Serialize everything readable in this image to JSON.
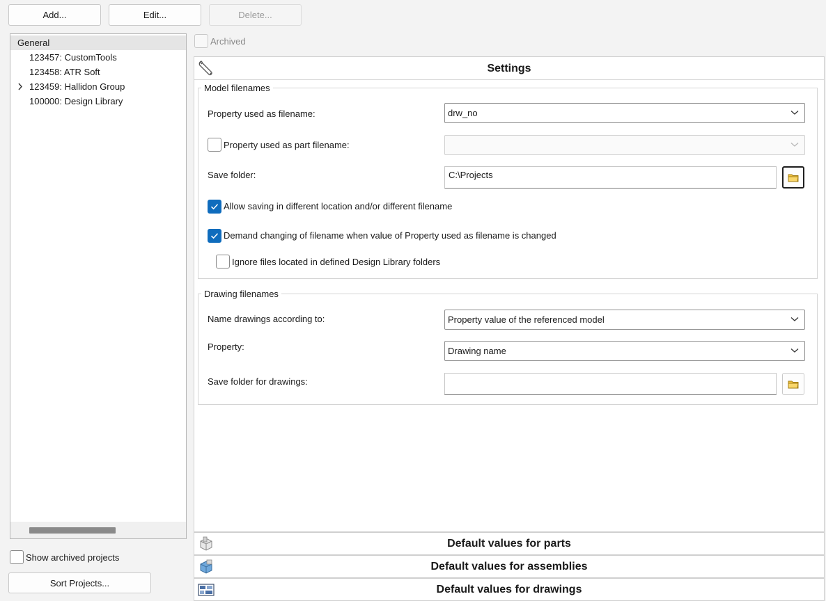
{
  "toolbar": {
    "add_label": "Add...",
    "edit_label": "Edit...",
    "delete_label": "Delete..."
  },
  "tree": {
    "items": [
      {
        "label": "General",
        "selected": true
      },
      {
        "label": "123457: CustomTools"
      },
      {
        "label": "123458: ATR Soft"
      },
      {
        "label": "123459: Hallidon Group",
        "expandable": true
      },
      {
        "label": "100000: Design Library"
      }
    ]
  },
  "left_bottom": {
    "show_archived_label": "Show archived projects",
    "sort_projects_label": "Sort Projects..."
  },
  "archived_label": "Archived",
  "settings": {
    "title": "Settings",
    "model_filenames": {
      "title": "Model filenames",
      "property_filename_label": "Property used as filename:",
      "property_filename_value": "drw_no",
      "part_filename_label": "Property used as part filename:",
      "part_filename_value": "",
      "save_folder_label": "Save folder:",
      "save_folder_value": "C:\\Projects",
      "allow_saving_label": "Allow saving in different location and/or different filename",
      "demand_changing_label": "Demand changing of filename when value of Property used as filename is changed",
      "ignore_files_label": "Ignore files located in defined Design Library folders"
    },
    "drawing_filenames": {
      "title": "Drawing filenames",
      "name_according_label": "Name drawings according to:",
      "name_according_value": "Property value of the referenced model",
      "property_label": "Property:",
      "property_value": "Drawing name",
      "save_folder_label": "Save folder for drawings:",
      "save_folder_value": ""
    }
  },
  "sections": {
    "parts": "Default values for parts",
    "assemblies": "Default values for assemblies",
    "drawings": "Default values for drawings"
  },
  "colors": {
    "accent": "#0f6cbd",
    "selection": "#e5e5e5"
  }
}
